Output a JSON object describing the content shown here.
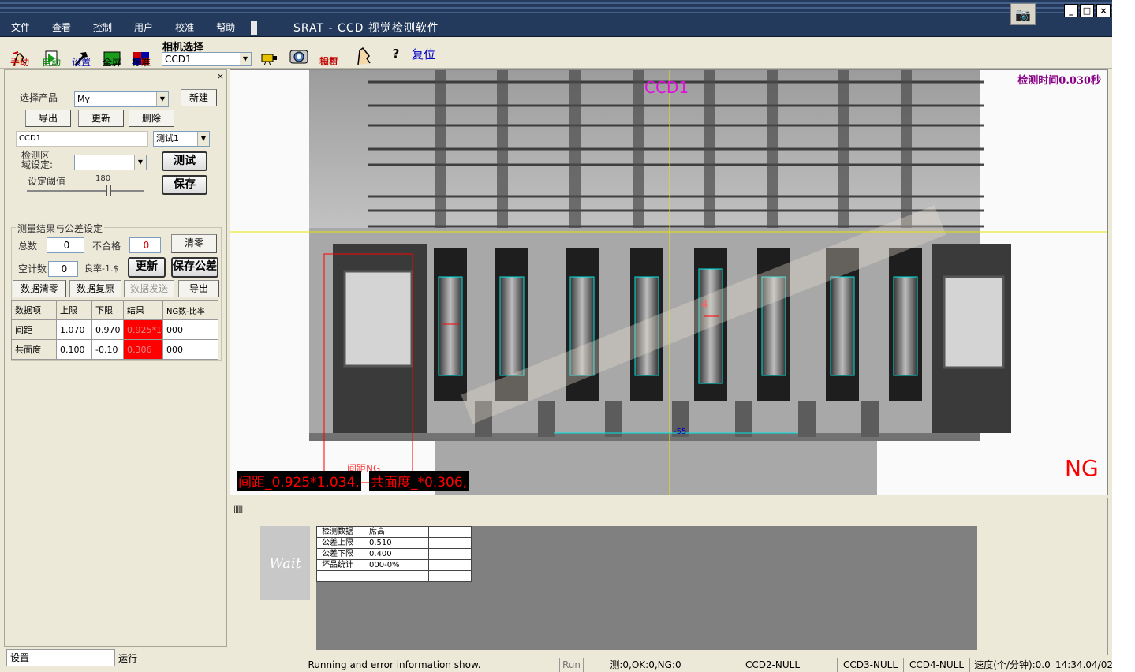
{
  "menu": [
    "文件",
    "查看",
    "控制",
    "用户",
    "校准",
    "帮助"
  ],
  "app_title": "SRAT - CCD 视觉检测软件",
  "window_buttons": [
    "_",
    "□",
    "×"
  ],
  "toolbar": {
    "manual": "手动",
    "auto": "自动",
    "settings": "设置",
    "fullscreen": "全屏",
    "standard": "标准",
    "camera_select_label": "相机选择",
    "camera_select_value": "CCD1",
    "camera_settings_line1": "相机",
    "camera_settings_line2": "设置",
    "help": "?",
    "reset": "复位"
  },
  "left_panel": {
    "close": "×",
    "select_product_label": "选择产品",
    "product_value": "My",
    "new_button": "新建",
    "export_button": "导出",
    "update_button": "更新",
    "delete_button": "删除",
    "ccd_value": "CCD1",
    "test_select_value": "测试1",
    "region_label_1": "检测区",
    "region_label_2": "域设定:",
    "region_value": "",
    "test_button": "测试",
    "save_button": "保存",
    "threshold_label": "设定阈值",
    "threshold_value": "180",
    "threshold_fraction": 0.7,
    "group_title": "测量结果与公差设定",
    "total_label": "总数",
    "total_value": "0",
    "fail_label": "不合格",
    "fail_value": "0",
    "clear_button": "清零",
    "empty_count_label": "空计数",
    "empty_count_value": "0",
    "yield_label": "良率-1.$",
    "refresh_button": "更新",
    "save_tol_button": "保存公差",
    "data_clear_button": "数据清零",
    "data_restore_button": "数据复原",
    "data_send_button": "数据发送",
    "data_export_button": "导出",
    "table": {
      "headers": [
        "数据项",
        "上限",
        "下限",
        "结果",
        "NG数-比率"
      ],
      "rows": [
        {
          "name": "间距",
          "upper": "1.070",
          "lower": "0.970",
          "result": "0.925*1",
          "ng": "000"
        },
        {
          "name": "共面度",
          "upper": "0.100",
          "lower": "-0.10",
          "result": "0.306",
          "ng": "000"
        }
      ]
    },
    "status_settings": "设置",
    "status_run": "运行"
  },
  "image_view": {
    "camera_label": "CCD1",
    "detect_time": "检测时间0.030秒",
    "result": "NG",
    "overlay_text_1": "间距_0.925*1.034,",
    "overlay_text_2": "共面度_*0.306,",
    "roi_label": "间距NG",
    "pin_number": "4",
    "base_label": "-55",
    "watermark_color": "#e8e0d0",
    "highlight_color": "#00e5e5",
    "ng_color": "#ff0000"
  },
  "bottom_panel": {
    "wait_label": "Wait",
    "info_table": [
      {
        "k": "检测数据",
        "v": "席高",
        "e": ""
      },
      {
        "k": "公差上限",
        "v": "0.510",
        "e": ""
      },
      {
        "k": "公差下限",
        "v": "0.400",
        "e": ""
      },
      {
        "k": "坏品统计",
        "v": "000-0%",
        "e": ""
      },
      {
        "k": "",
        "v": "",
        "e": ""
      }
    ]
  },
  "status_bar": {
    "message": "Running and error information show.",
    "run": "Run",
    "counts": "测:0,OK:0,NG:0",
    "ccd2": "CCD2-NULL",
    "ccd3": "CCD3-NULL",
    "ccd4": "CCD4-NULL",
    "speed": "速度(个/分钟):0.0",
    "time": "14:34.04/02"
  }
}
